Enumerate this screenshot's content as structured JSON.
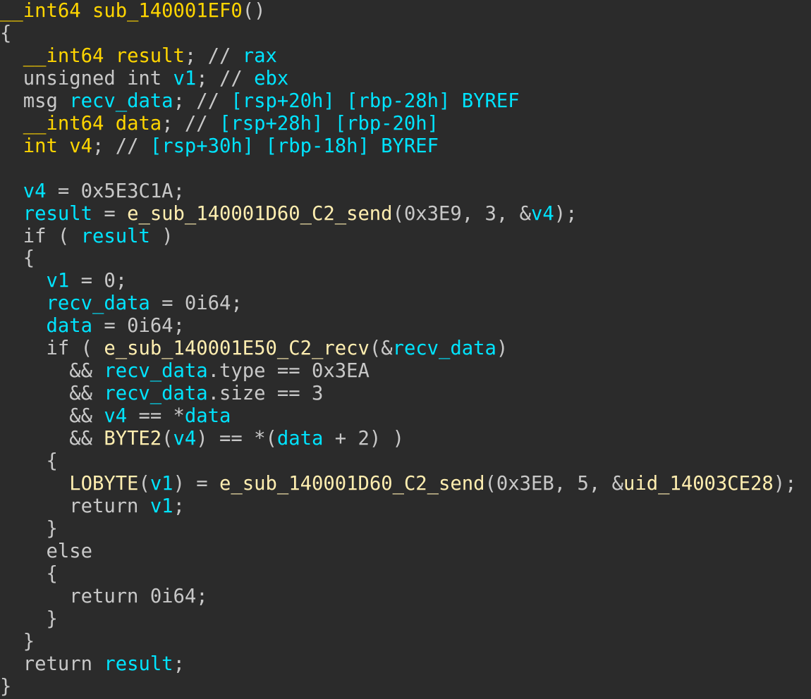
{
  "editor": {
    "function_signature": "__int64 sub_140001EF0()",
    "lines": [
      [
        {
          "t": "__int64 ",
          "c": "type"
        },
        {
          "t": "sub_140001EF0",
          "c": "highlight"
        },
        {
          "t": "()",
          "c": "punc"
        }
      ],
      [
        {
          "t": "{",
          "c": "punc"
        }
      ],
      [
        {
          "t": "  ",
          "c": "plain"
        },
        {
          "t": "__int64 ",
          "c": "type"
        },
        {
          "t": "result",
          "c": "highlight"
        },
        {
          "t": "; // ",
          "c": "punc"
        },
        {
          "t": "rax",
          "c": "cmt"
        }
      ],
      [
        {
          "t": "  ",
          "c": "plain"
        },
        {
          "t": "unsigned int ",
          "c": "kw"
        },
        {
          "t": "v1",
          "c": "var"
        },
        {
          "t": "; // ",
          "c": "punc"
        },
        {
          "t": "ebx",
          "c": "cmt"
        }
      ],
      [
        {
          "t": "  ",
          "c": "plain"
        },
        {
          "t": "msg ",
          "c": "kw"
        },
        {
          "t": "recv_data",
          "c": "var"
        },
        {
          "t": "; // ",
          "c": "punc"
        },
        {
          "t": "[rsp+20h] [rbp-28h] BYREF",
          "c": "cmt"
        }
      ],
      [
        {
          "t": "  ",
          "c": "plain"
        },
        {
          "t": "__int64 ",
          "c": "type"
        },
        {
          "t": "data",
          "c": "highlight"
        },
        {
          "t": "; // ",
          "c": "punc"
        },
        {
          "t": "[rsp+28h] [rbp-20h]",
          "c": "cmt"
        }
      ],
      [
        {
          "t": "  ",
          "c": "plain"
        },
        {
          "t": "int ",
          "c": "type"
        },
        {
          "t": "v4",
          "c": "highlight"
        },
        {
          "t": "; // ",
          "c": "punc"
        },
        {
          "t": "[rsp+30h] [rbp-18h] BYREF",
          "c": "cmt"
        }
      ],
      [],
      [
        {
          "t": "  ",
          "c": "plain"
        },
        {
          "t": "v4",
          "c": "var"
        },
        {
          "t": " = ",
          "c": "punc"
        },
        {
          "t": "0x5E3C1A",
          "c": "num"
        },
        {
          "t": ";",
          "c": "punc"
        }
      ],
      [
        {
          "t": "  ",
          "c": "plain"
        },
        {
          "t": "result",
          "c": "var"
        },
        {
          "t": " = ",
          "c": "punc"
        },
        {
          "t": "e_sub_140001D60_C2_send",
          "c": "func"
        },
        {
          "t": "(",
          "c": "punc"
        },
        {
          "t": "0x3E9",
          "c": "num"
        },
        {
          "t": ", ",
          "c": "punc"
        },
        {
          "t": "3",
          "c": "num"
        },
        {
          "t": ", &",
          "c": "punc"
        },
        {
          "t": "v4",
          "c": "var"
        },
        {
          "t": ");",
          "c": "punc"
        }
      ],
      [
        {
          "t": "  ",
          "c": "plain"
        },
        {
          "t": "if",
          "c": "kw"
        },
        {
          "t": " ( ",
          "c": "punc"
        },
        {
          "t": "result",
          "c": "var"
        },
        {
          "t": " )",
          "c": "punc"
        }
      ],
      [
        {
          "t": "  {",
          "c": "punc"
        }
      ],
      [
        {
          "t": "    ",
          "c": "plain"
        },
        {
          "t": "v1",
          "c": "var"
        },
        {
          "t": " = ",
          "c": "punc"
        },
        {
          "t": "0",
          "c": "num"
        },
        {
          "t": ";",
          "c": "punc"
        }
      ],
      [
        {
          "t": "    ",
          "c": "plain"
        },
        {
          "t": "recv_data",
          "c": "var"
        },
        {
          "t": " = ",
          "c": "punc"
        },
        {
          "t": "0i64",
          "c": "num"
        },
        {
          "t": ";",
          "c": "punc"
        }
      ],
      [
        {
          "t": "    ",
          "c": "plain"
        },
        {
          "t": "data",
          "c": "var"
        },
        {
          "t": " = ",
          "c": "punc"
        },
        {
          "t": "0i64",
          "c": "num"
        },
        {
          "t": ";",
          "c": "punc"
        }
      ],
      [
        {
          "t": "    ",
          "c": "plain"
        },
        {
          "t": "if",
          "c": "kw"
        },
        {
          "t": " ( ",
          "c": "punc"
        },
        {
          "t": "e_sub_140001E50_C2_recv",
          "c": "func"
        },
        {
          "t": "(&",
          "c": "punc"
        },
        {
          "t": "recv_data",
          "c": "var"
        },
        {
          "t": ")",
          "c": "punc"
        }
      ],
      [
        {
          "t": "      && ",
          "c": "punc"
        },
        {
          "t": "recv_data",
          "c": "var"
        },
        {
          "t": ".type",
          "c": "plain"
        },
        {
          "t": " == ",
          "c": "punc"
        },
        {
          "t": "0x3EA",
          "c": "num"
        }
      ],
      [
        {
          "t": "      && ",
          "c": "punc"
        },
        {
          "t": "recv_data",
          "c": "var"
        },
        {
          "t": ".size",
          "c": "plain"
        },
        {
          "t": " == ",
          "c": "punc"
        },
        {
          "t": "3",
          "c": "num"
        }
      ],
      [
        {
          "t": "      && ",
          "c": "punc"
        },
        {
          "t": "v4",
          "c": "var"
        },
        {
          "t": " == *",
          "c": "punc"
        },
        {
          "t": "data",
          "c": "var"
        }
      ],
      [
        {
          "t": "      && ",
          "c": "punc"
        },
        {
          "t": "BYTE2",
          "c": "func"
        },
        {
          "t": "(",
          "c": "punc"
        },
        {
          "t": "v4",
          "c": "var"
        },
        {
          "t": ") == *(",
          "c": "punc"
        },
        {
          "t": "data",
          "c": "var"
        },
        {
          "t": " + ",
          "c": "punc"
        },
        {
          "t": "2",
          "c": "num"
        },
        {
          "t": ") )",
          "c": "punc"
        }
      ],
      [
        {
          "t": "    {",
          "c": "punc"
        }
      ],
      [
        {
          "t": "      ",
          "c": "plain"
        },
        {
          "t": "LOBYTE",
          "c": "func"
        },
        {
          "t": "(",
          "c": "punc"
        },
        {
          "t": "v1",
          "c": "var"
        },
        {
          "t": ") = ",
          "c": "punc"
        },
        {
          "t": "e_sub_140001D60_C2_send",
          "c": "func"
        },
        {
          "t": "(",
          "c": "punc"
        },
        {
          "t": "0x3EB",
          "c": "num"
        },
        {
          "t": ", ",
          "c": "punc"
        },
        {
          "t": "5",
          "c": "num"
        },
        {
          "t": ", &",
          "c": "punc"
        },
        {
          "t": "uid_14003CE28",
          "c": "ctx"
        },
        {
          "t": ");",
          "c": "punc"
        }
      ],
      [
        {
          "t": "      ",
          "c": "plain"
        },
        {
          "t": "return",
          "c": "kw"
        },
        {
          "t": " ",
          "c": "plain"
        },
        {
          "t": "v1",
          "c": "var"
        },
        {
          "t": ";",
          "c": "punc"
        }
      ],
      [
        {
          "t": "    }",
          "c": "punc"
        }
      ],
      [
        {
          "t": "    ",
          "c": "plain"
        },
        {
          "t": "else",
          "c": "kw"
        }
      ],
      [
        {
          "t": "    {",
          "c": "punc"
        }
      ],
      [
        {
          "t": "      ",
          "c": "plain"
        },
        {
          "t": "return",
          "c": "kw"
        },
        {
          "t": " ",
          "c": "plain"
        },
        {
          "t": "0i64",
          "c": "num"
        },
        {
          "t": ";",
          "c": "punc"
        }
      ],
      [
        {
          "t": "    }",
          "c": "punc"
        }
      ],
      [
        {
          "t": "  }",
          "c": "punc"
        }
      ],
      [
        {
          "t": "  ",
          "c": "plain"
        },
        {
          "t": "return",
          "c": "kw"
        },
        {
          "t": " ",
          "c": "plain"
        },
        {
          "t": "result",
          "c": "var"
        },
        {
          "t": ";",
          "c": "punc"
        }
      ],
      [
        {
          "t": "}",
          "c": "punc"
        }
      ]
    ]
  },
  "colors": {
    "background": "#2b2b2b",
    "keyword": "#c8c8c8",
    "type": "#ffd500",
    "function": "#ffeeb0",
    "variable": "#00e4ff",
    "comment": "#00e4ff",
    "punctuation": "#c8c8c8"
  }
}
